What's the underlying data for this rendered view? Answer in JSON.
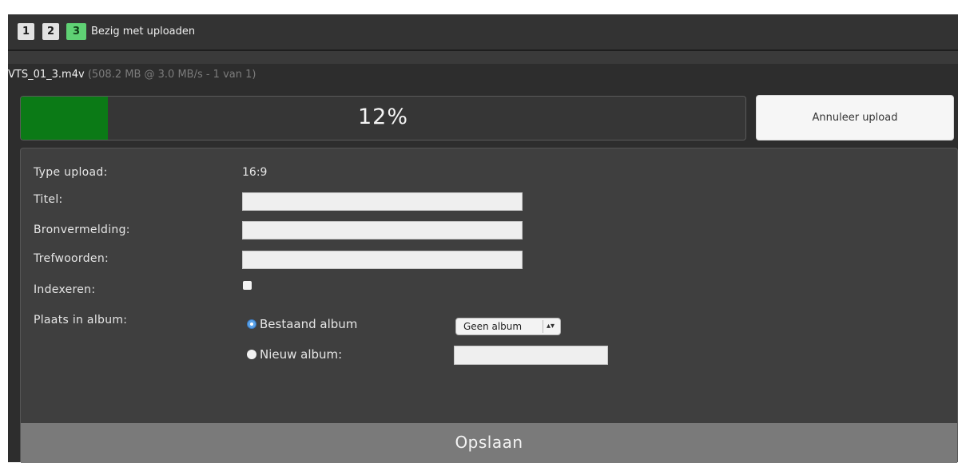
{
  "steps": {
    "items": [
      "1",
      "2",
      "3"
    ],
    "active_index": 3,
    "status": "Bezig met uploaden"
  },
  "file": {
    "name": "VTS_01_3.m4v",
    "meta": "(508.2 MB @ 3.0 MB/s - 1 van 1)"
  },
  "progress": {
    "percent_label": "12%",
    "fill_fraction": 0.12
  },
  "cancel_button": "Annuleer upload",
  "form": {
    "type_label": "Type upload:",
    "type_value": "16:9",
    "title_label": "Titel:",
    "title_value": "",
    "source_label": "Bronvermelding:",
    "source_value": "",
    "keywords_label": "Trefwoorden:",
    "keywords_value": "",
    "index_label": "Indexeren:",
    "index_checked": false,
    "album_label": "Plaats in album:",
    "existing_album_option": "Bestaand album",
    "existing_album_selected": true,
    "album_select_value": "Geen album",
    "new_album_option": "Nieuw album:",
    "new_album_value": ""
  },
  "save_button": "Opslaan",
  "colors": {
    "progress_fill": "#0b7a16",
    "active_step": "#5fd174",
    "radio_selected": "#5aa2e8"
  }
}
